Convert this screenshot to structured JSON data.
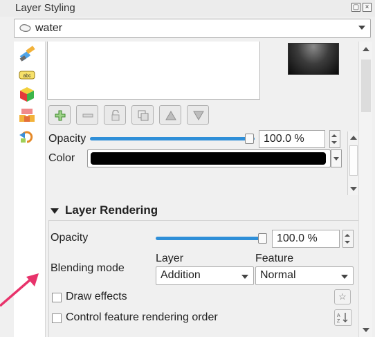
{
  "window": {
    "title": "Layer Styling"
  },
  "layer_selector": {
    "value": "water"
  },
  "symbol_section": {
    "opacity_label": "Opacity",
    "opacity_value": "100.0 %",
    "color_label": "Color",
    "color_value": "#000000"
  },
  "layer_rendering": {
    "title": "Layer Rendering",
    "opacity_label": "Opacity",
    "opacity_value": "100.0 %",
    "opacity_fraction": 1.0,
    "blending_mode_label": "Blending mode",
    "layer_label": "Layer",
    "feature_label": "Feature",
    "layer_blend_value": "Addition",
    "feature_blend_value": "Normal",
    "draw_effects_label": "Draw effects",
    "draw_effects_checked": false,
    "control_order_label": "Control feature rendering order",
    "control_order_checked": false
  },
  "colors": {
    "accent": "#2f8fd8",
    "annotation_arrow": "#e8336b"
  }
}
